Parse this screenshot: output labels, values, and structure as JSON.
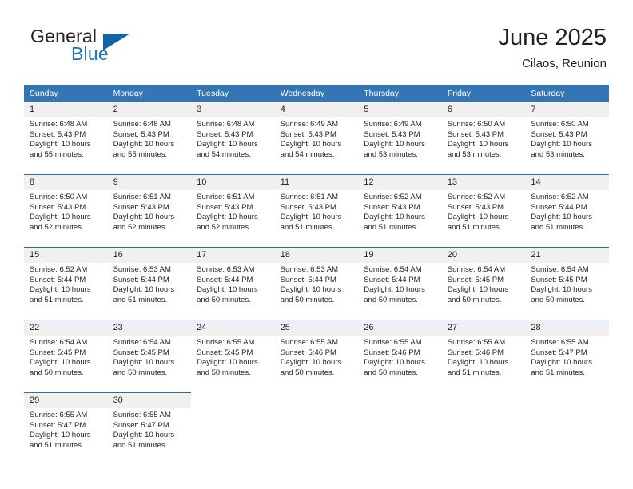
{
  "brand": {
    "name_part1": "General",
    "name_part2": "Blue",
    "flag_icon": "flag-triangle-icon"
  },
  "header": {
    "title": "June 2025",
    "location": "Cilaos, Reunion"
  },
  "colors": {
    "header_blue": "#3575b4",
    "rule_blue": "#2f6aa8",
    "brand_blue": "#1b75bc",
    "daynum_band": "#f0f0f0",
    "text": "#231f20"
  },
  "weekdays": [
    "Sunday",
    "Monday",
    "Tuesday",
    "Wednesday",
    "Thursday",
    "Friday",
    "Saturday"
  ],
  "weeks": [
    [
      {
        "day": "1",
        "sunrise": "Sunrise: 6:48 AM",
        "sunset": "Sunset: 5:43 PM",
        "daylight1": "Daylight: 10 hours",
        "daylight2": "and 55 minutes."
      },
      {
        "day": "2",
        "sunrise": "Sunrise: 6:48 AM",
        "sunset": "Sunset: 5:43 PM",
        "daylight1": "Daylight: 10 hours",
        "daylight2": "and 55 minutes."
      },
      {
        "day": "3",
        "sunrise": "Sunrise: 6:48 AM",
        "sunset": "Sunset: 5:43 PM",
        "daylight1": "Daylight: 10 hours",
        "daylight2": "and 54 minutes."
      },
      {
        "day": "4",
        "sunrise": "Sunrise: 6:49 AM",
        "sunset": "Sunset: 5:43 PM",
        "daylight1": "Daylight: 10 hours",
        "daylight2": "and 54 minutes."
      },
      {
        "day": "5",
        "sunrise": "Sunrise: 6:49 AM",
        "sunset": "Sunset: 5:43 PM",
        "daylight1": "Daylight: 10 hours",
        "daylight2": "and 53 minutes."
      },
      {
        "day": "6",
        "sunrise": "Sunrise: 6:50 AM",
        "sunset": "Sunset: 5:43 PM",
        "daylight1": "Daylight: 10 hours",
        "daylight2": "and 53 minutes."
      },
      {
        "day": "7",
        "sunrise": "Sunrise: 6:50 AM",
        "sunset": "Sunset: 5:43 PM",
        "daylight1": "Daylight: 10 hours",
        "daylight2": "and 53 minutes."
      }
    ],
    [
      {
        "day": "8",
        "sunrise": "Sunrise: 6:50 AM",
        "sunset": "Sunset: 5:43 PM",
        "daylight1": "Daylight: 10 hours",
        "daylight2": "and 52 minutes."
      },
      {
        "day": "9",
        "sunrise": "Sunrise: 6:51 AM",
        "sunset": "Sunset: 5:43 PM",
        "daylight1": "Daylight: 10 hours",
        "daylight2": "and 52 minutes."
      },
      {
        "day": "10",
        "sunrise": "Sunrise: 6:51 AM",
        "sunset": "Sunset: 5:43 PM",
        "daylight1": "Daylight: 10 hours",
        "daylight2": "and 52 minutes."
      },
      {
        "day": "11",
        "sunrise": "Sunrise: 6:51 AM",
        "sunset": "Sunset: 5:43 PM",
        "daylight1": "Daylight: 10 hours",
        "daylight2": "and 51 minutes."
      },
      {
        "day": "12",
        "sunrise": "Sunrise: 6:52 AM",
        "sunset": "Sunset: 5:43 PM",
        "daylight1": "Daylight: 10 hours",
        "daylight2": "and 51 minutes."
      },
      {
        "day": "13",
        "sunrise": "Sunrise: 6:52 AM",
        "sunset": "Sunset: 5:43 PM",
        "daylight1": "Daylight: 10 hours",
        "daylight2": "and 51 minutes."
      },
      {
        "day": "14",
        "sunrise": "Sunrise: 6:52 AM",
        "sunset": "Sunset: 5:44 PM",
        "daylight1": "Daylight: 10 hours",
        "daylight2": "and 51 minutes."
      }
    ],
    [
      {
        "day": "15",
        "sunrise": "Sunrise: 6:52 AM",
        "sunset": "Sunset: 5:44 PM",
        "daylight1": "Daylight: 10 hours",
        "daylight2": "and 51 minutes."
      },
      {
        "day": "16",
        "sunrise": "Sunrise: 6:53 AM",
        "sunset": "Sunset: 5:44 PM",
        "daylight1": "Daylight: 10 hours",
        "daylight2": "and 51 minutes."
      },
      {
        "day": "17",
        "sunrise": "Sunrise: 6:53 AM",
        "sunset": "Sunset: 5:44 PM",
        "daylight1": "Daylight: 10 hours",
        "daylight2": "and 50 minutes."
      },
      {
        "day": "18",
        "sunrise": "Sunrise: 6:53 AM",
        "sunset": "Sunset: 5:44 PM",
        "daylight1": "Daylight: 10 hours",
        "daylight2": "and 50 minutes."
      },
      {
        "day": "19",
        "sunrise": "Sunrise: 6:54 AM",
        "sunset": "Sunset: 5:44 PM",
        "daylight1": "Daylight: 10 hours",
        "daylight2": "and 50 minutes."
      },
      {
        "day": "20",
        "sunrise": "Sunrise: 6:54 AM",
        "sunset": "Sunset: 5:45 PM",
        "daylight1": "Daylight: 10 hours",
        "daylight2": "and 50 minutes."
      },
      {
        "day": "21",
        "sunrise": "Sunrise: 6:54 AM",
        "sunset": "Sunset: 5:45 PM",
        "daylight1": "Daylight: 10 hours",
        "daylight2": "and 50 minutes."
      }
    ],
    [
      {
        "day": "22",
        "sunrise": "Sunrise: 6:54 AM",
        "sunset": "Sunset: 5:45 PM",
        "daylight1": "Daylight: 10 hours",
        "daylight2": "and 50 minutes."
      },
      {
        "day": "23",
        "sunrise": "Sunrise: 6:54 AM",
        "sunset": "Sunset: 5:45 PM",
        "daylight1": "Daylight: 10 hours",
        "daylight2": "and 50 minutes."
      },
      {
        "day": "24",
        "sunrise": "Sunrise: 6:55 AM",
        "sunset": "Sunset: 5:45 PM",
        "daylight1": "Daylight: 10 hours",
        "daylight2": "and 50 minutes."
      },
      {
        "day": "25",
        "sunrise": "Sunrise: 6:55 AM",
        "sunset": "Sunset: 5:46 PM",
        "daylight1": "Daylight: 10 hours",
        "daylight2": "and 50 minutes."
      },
      {
        "day": "26",
        "sunrise": "Sunrise: 6:55 AM",
        "sunset": "Sunset: 5:46 PM",
        "daylight1": "Daylight: 10 hours",
        "daylight2": "and 50 minutes."
      },
      {
        "day": "27",
        "sunrise": "Sunrise: 6:55 AM",
        "sunset": "Sunset: 5:46 PM",
        "daylight1": "Daylight: 10 hours",
        "daylight2": "and 51 minutes."
      },
      {
        "day": "28",
        "sunrise": "Sunrise: 6:55 AM",
        "sunset": "Sunset: 5:47 PM",
        "daylight1": "Daylight: 10 hours",
        "daylight2": "and 51 minutes."
      }
    ],
    [
      {
        "day": "29",
        "sunrise": "Sunrise: 6:55 AM",
        "sunset": "Sunset: 5:47 PM",
        "daylight1": "Daylight: 10 hours",
        "daylight2": "and 51 minutes."
      },
      {
        "day": "30",
        "sunrise": "Sunrise: 6:55 AM",
        "sunset": "Sunset: 5:47 PM",
        "daylight1": "Daylight: 10 hours",
        "daylight2": "and 51 minutes."
      },
      {
        "day": "",
        "sunrise": "",
        "sunset": "",
        "daylight1": "",
        "daylight2": ""
      },
      {
        "day": "",
        "sunrise": "",
        "sunset": "",
        "daylight1": "",
        "daylight2": ""
      },
      {
        "day": "",
        "sunrise": "",
        "sunset": "",
        "daylight1": "",
        "daylight2": ""
      },
      {
        "day": "",
        "sunrise": "",
        "sunset": "",
        "daylight1": "",
        "daylight2": ""
      },
      {
        "day": "",
        "sunrise": "",
        "sunset": "",
        "daylight1": "",
        "daylight2": ""
      }
    ]
  ]
}
